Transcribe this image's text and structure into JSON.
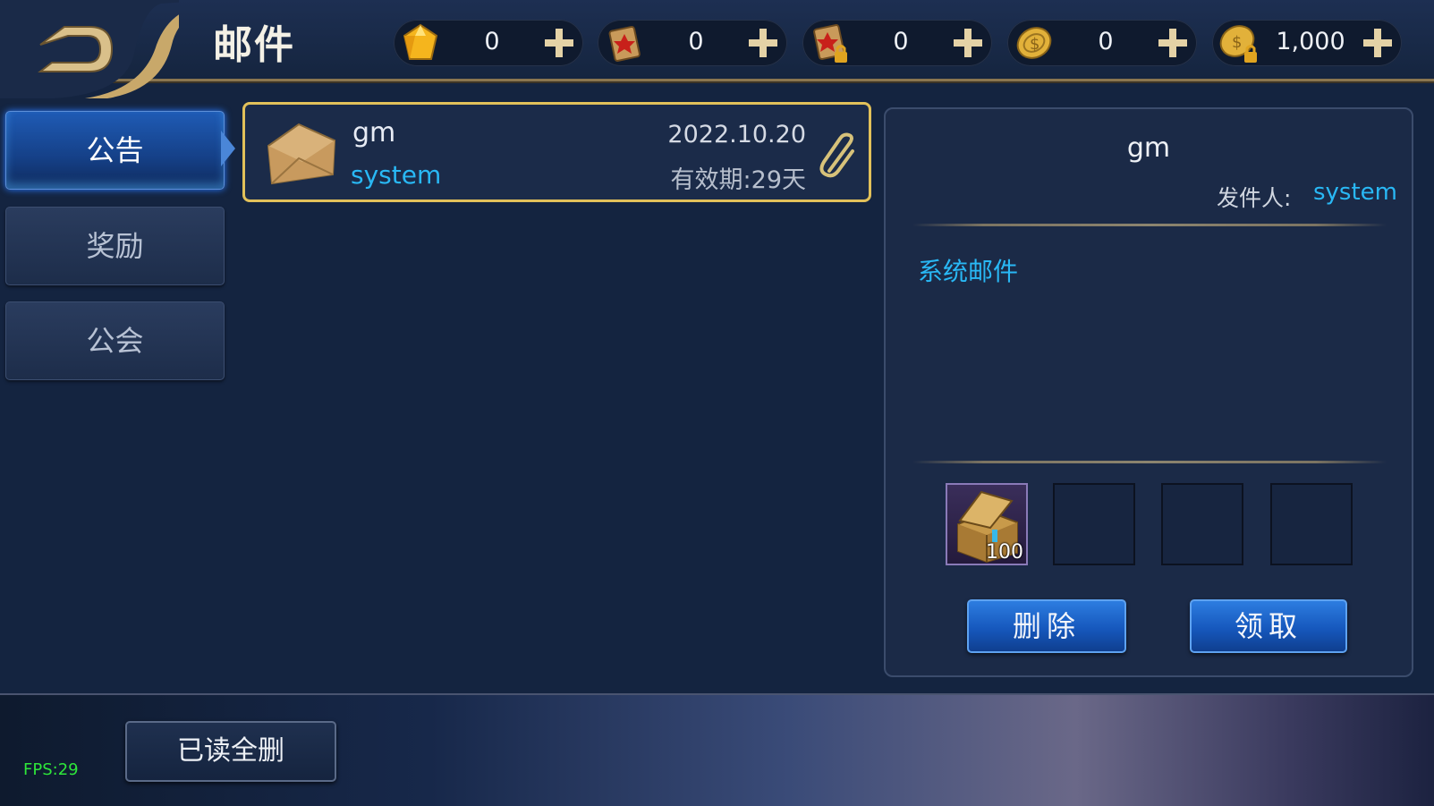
{
  "header": {
    "title": "邮件"
  },
  "resources": [
    {
      "icon": "gem-icon",
      "value": "0"
    },
    {
      "icon": "scroll-icon",
      "value": "0"
    },
    {
      "icon": "locked-scroll-icon",
      "value": "0"
    },
    {
      "icon": "gold-coin-icon",
      "value": "0"
    },
    {
      "icon": "locked-coin-icon",
      "value": "1,000"
    }
  ],
  "tabs": [
    {
      "label": "公告",
      "active": true
    },
    {
      "label": "奖励",
      "active": false
    },
    {
      "label": "公会",
      "active": false
    }
  ],
  "mail_list": [
    {
      "subject": "gm",
      "sender": "system",
      "date": "2022.10.20",
      "expiry": "有效期:29天",
      "has_attachment": true
    }
  ],
  "detail": {
    "title": "gm",
    "sender_label": "发件人:",
    "sender": "system",
    "body": "系统邮件",
    "attachments": [
      {
        "icon": "treasure-chest-icon",
        "qty": "100"
      }
    ],
    "delete_label": "删除",
    "claim_label": "领取"
  },
  "footer": {
    "delete_read_label": "已读全删",
    "fps": "FPS:29"
  },
  "colors": {
    "accent_blue": "#29b8f5",
    "gold_border": "#e2c15a",
    "fps_green": "#2ee63a"
  }
}
